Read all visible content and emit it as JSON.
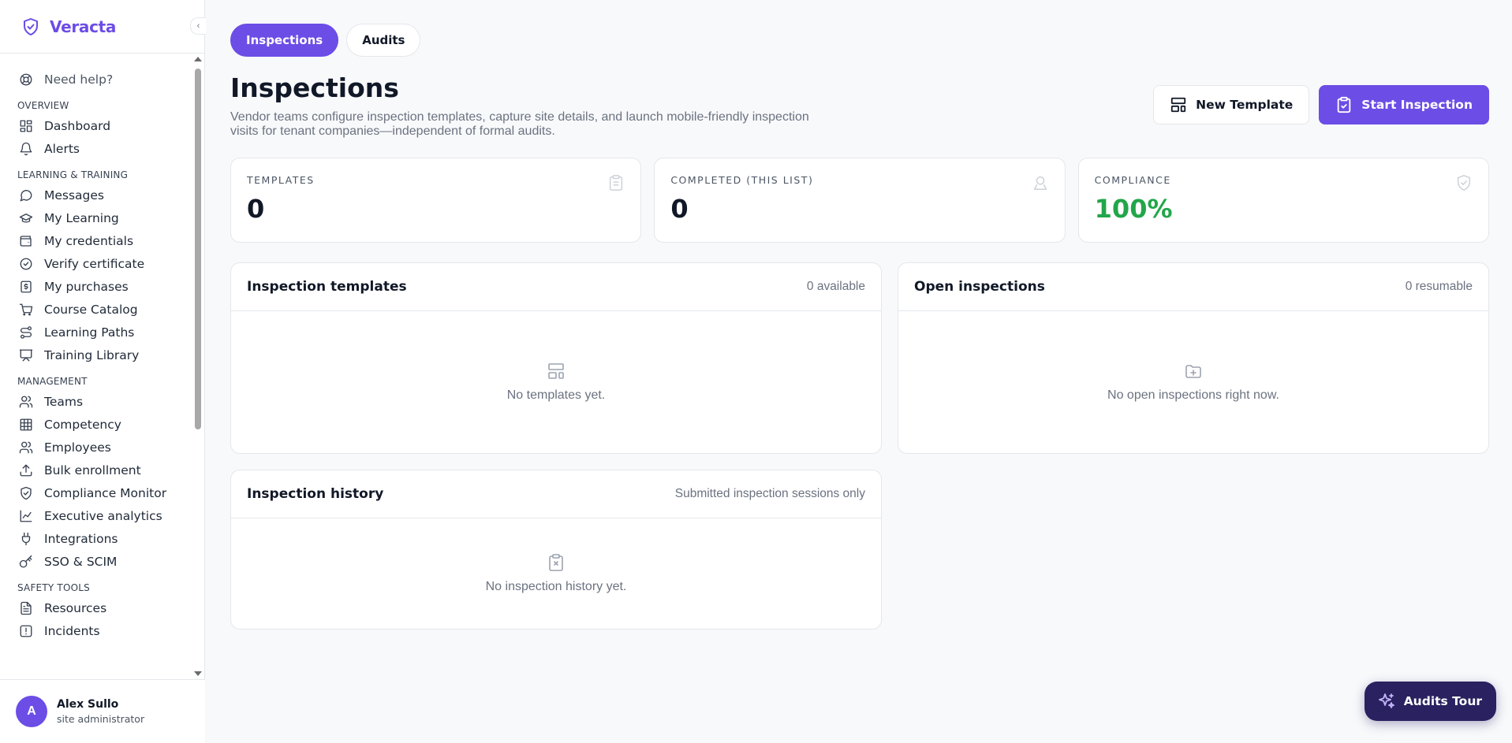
{
  "app": {
    "name": "Veracta",
    "logo_icon": "shield-check-icon"
  },
  "sidebar": {
    "help": {
      "label": "Need help?",
      "icon": "life-buoy-icon"
    },
    "sections": [
      {
        "title": "OVERVIEW",
        "items": [
          {
            "label": "Dashboard",
            "icon": "layout-grid-icon"
          },
          {
            "label": "Alerts",
            "icon": "bell-icon"
          }
        ]
      },
      {
        "title": "LEARNING & TRAINING",
        "items": [
          {
            "label": "Messages",
            "icon": "message-circle-icon"
          },
          {
            "label": "My Learning",
            "icon": "graduation-cap-icon"
          },
          {
            "label": "My credentials",
            "icon": "wallet-icon"
          },
          {
            "label": "Verify certificate",
            "icon": "check-circle-icon"
          },
          {
            "label": "My purchases",
            "icon": "dollar-receipt-icon"
          },
          {
            "label": "Course Catalog",
            "icon": "shopping-cart-icon"
          },
          {
            "label": "Learning Paths",
            "icon": "route-icon"
          },
          {
            "label": "Training Library",
            "icon": "presentation-icon"
          }
        ]
      },
      {
        "title": "MANAGEMENT",
        "items": [
          {
            "label": "Teams",
            "icon": "users-icon"
          },
          {
            "label": "Competency",
            "icon": "table-grid-icon"
          },
          {
            "label": "Employees",
            "icon": "user-group-icon"
          },
          {
            "label": "Bulk enrollment",
            "icon": "upload-icon"
          },
          {
            "label": "Compliance Monitor",
            "icon": "shield-check-icon"
          },
          {
            "label": "Executive analytics",
            "icon": "line-chart-icon"
          },
          {
            "label": "Integrations",
            "icon": "plug-icon"
          },
          {
            "label": "SSO & SCIM",
            "icon": "key-icon"
          }
        ]
      },
      {
        "title": "SAFETY TOOLS",
        "items": [
          {
            "label": "Resources",
            "icon": "file-text-icon"
          },
          {
            "label": "Incidents",
            "icon": "alert-square-icon"
          }
        ]
      }
    ]
  },
  "user": {
    "initial": "A",
    "name": "Alex Sullo",
    "role": "site administrator"
  },
  "tabs": [
    {
      "label": "Inspections",
      "active": true
    },
    {
      "label": "Audits",
      "active": false
    }
  ],
  "page": {
    "title": "Inspections",
    "description": "Vendor teams configure inspection templates, capture site details, and launch mobile-friendly inspection visits for tenant companies—independent of formal audits."
  },
  "actions": {
    "new_template": "New Template",
    "start_inspection": "Start Inspection"
  },
  "stats": [
    {
      "label": "TEMPLATES",
      "value": "0",
      "icon": "clipboard-icon"
    },
    {
      "label": "COMPLETED (THIS LIST)",
      "value": "0",
      "icon": "user-badge-icon"
    },
    {
      "label": "COMPLIANCE",
      "value": "100%",
      "icon": "shield-check-icon",
      "color": "#22a64a"
    }
  ],
  "panels": {
    "templates": {
      "title": "Inspection templates",
      "meta": "0 available",
      "empty": "No templates yet.",
      "icon": "layout-template-icon"
    },
    "open": {
      "title": "Open inspections",
      "meta": "0 resumable",
      "empty": "No open inspections right now.",
      "icon": "folder-open-icon"
    },
    "history": {
      "title": "Inspection history",
      "meta": "Submitted inspection sessions only",
      "empty": "No inspection history yet.",
      "icon": "clipboard-x-icon"
    }
  },
  "tour": {
    "label": "Audits Tour",
    "icon": "sparkles-icon"
  },
  "colors": {
    "accent": "#6c4de6",
    "success": "#22a64a",
    "tour_bg": "#2a2160"
  }
}
